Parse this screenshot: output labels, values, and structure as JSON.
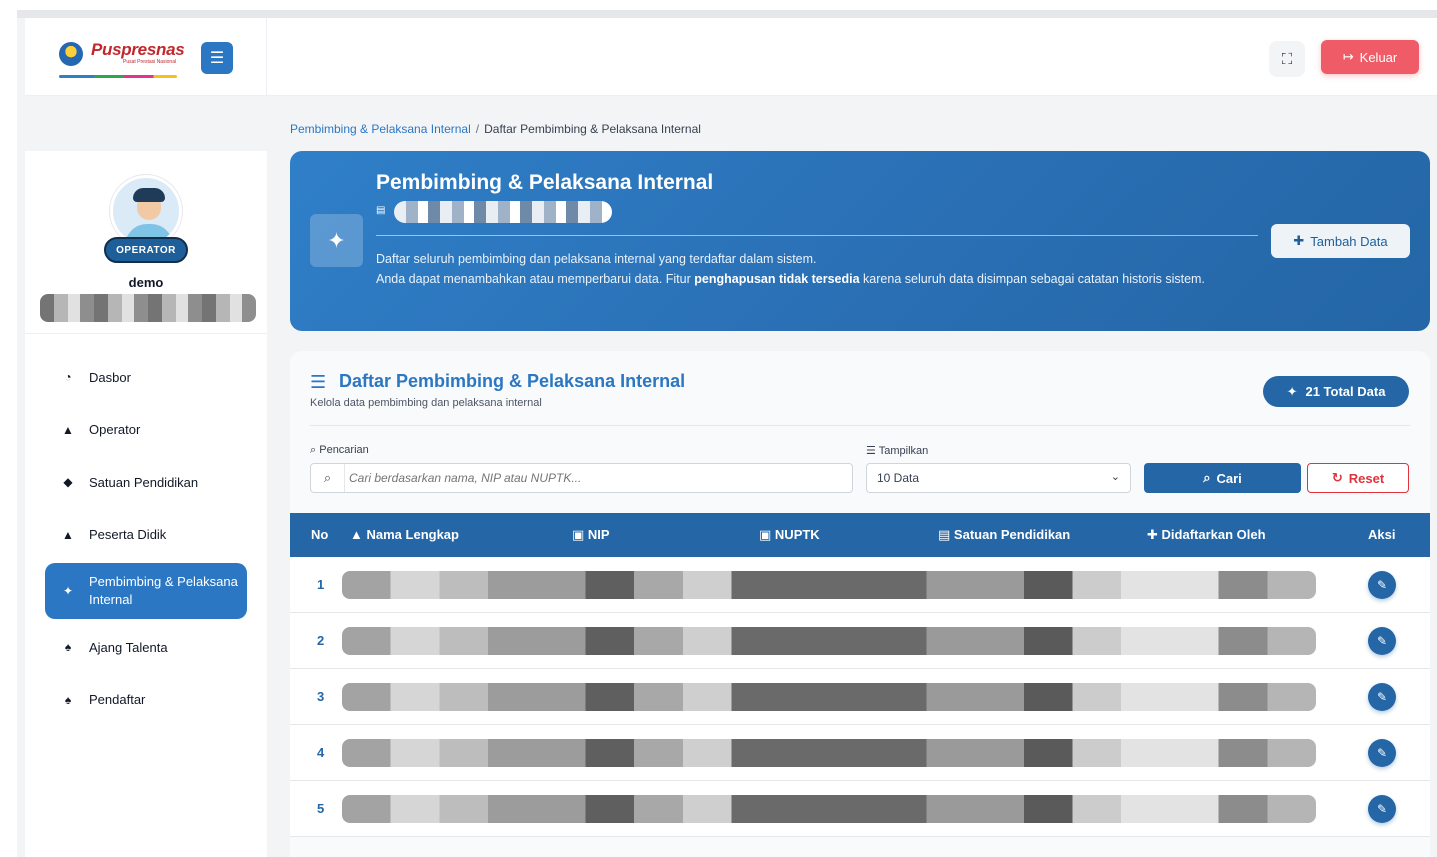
{
  "app": {
    "logo_text": "Puspresnas",
    "logo_sub": "Pusat Prestasi Nasional"
  },
  "header": {
    "logout_label": "Keluar"
  },
  "user": {
    "role": "OPERATOR",
    "name": "demo"
  },
  "sidebar": {
    "items": [
      {
        "label": "Dasbor",
        "icon": "dashboard-icon",
        "active": false
      },
      {
        "label": "Operator",
        "icon": "user-icon",
        "active": false
      },
      {
        "label": "Satuan Pendidikan",
        "icon": "graduation-cap-icon",
        "active": false
      },
      {
        "label": "Peserta Didik",
        "icon": "user-icon",
        "active": false
      },
      {
        "label": "Pembimbing & Pelaksana Internal",
        "icon": "users-icon",
        "active": true
      },
      {
        "label": "Ajang Talenta",
        "icon": "trophy-icon",
        "active": false
      },
      {
        "label": "Pendaftar",
        "icon": "trophy-icon",
        "active": false
      }
    ]
  },
  "breadcrumb": {
    "parent": "Pembimbing & Pelaksana Internal",
    "separator": "/",
    "current": "Daftar Pembimbing & Pelaksana Internal"
  },
  "hero": {
    "title": "Pembimbing & Pelaksana Internal",
    "desc_line1": "Daftar seluruh pembimbing dan pelaksana internal yang terdaftar dalam sistem.",
    "desc_line2_pre": "Anda dapat menambahkan atau memperbarui data. Fitur ",
    "desc_line2_bold": "penghapusan tidak tersedia",
    "desc_line2_post": " karena seluruh data disimpan sebagai catatan historis sistem.",
    "add_button": "Tambah Data"
  },
  "list": {
    "title": "Daftar Pembimbing & Pelaksana Internal",
    "subtitle": "Kelola data pembimbing dan pelaksana internal",
    "total_badge": "21 Total Data",
    "search_label": "Pencarian",
    "search_placeholder": "Cari berdasarkan nama, NIP atau NUPTK...",
    "show_label": "Tampilkan",
    "show_value": "10 Data",
    "search_button": "Cari",
    "reset_button": "Reset"
  },
  "table": {
    "columns": [
      "No",
      "Nama Lengkap",
      "NIP",
      "NUPTK",
      "Satuan Pendidikan",
      "Didaftarkan Oleh",
      "Aksi"
    ],
    "rows": [
      {
        "no": "1"
      },
      {
        "no": "2"
      },
      {
        "no": "3"
      },
      {
        "no": "4"
      },
      {
        "no": "5"
      }
    ]
  },
  "colors": {
    "primary": "#2466a6",
    "accent": "#2b77c4",
    "danger": "#ef5b66"
  }
}
